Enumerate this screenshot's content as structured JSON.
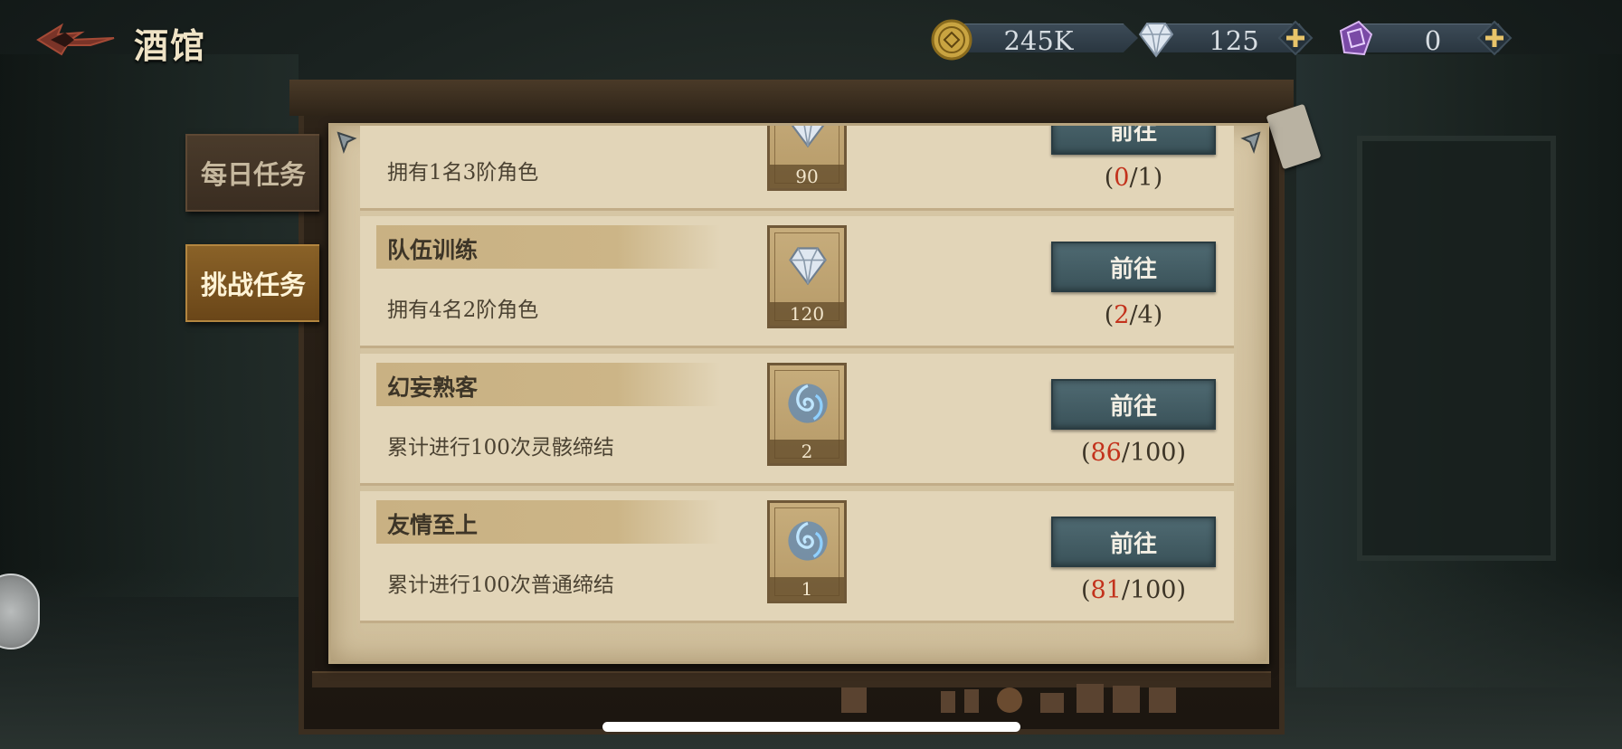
{
  "header": {
    "title": "酒馆"
  },
  "currencies": [
    {
      "name": "coin",
      "icon": "coin-icon",
      "value": "245K"
    },
    {
      "name": "diamond",
      "icon": "diamond-icon",
      "value": "125"
    },
    {
      "name": "crystal",
      "icon": "purple-crystal-icon",
      "value": "0"
    }
  ],
  "tabs": [
    {
      "label": "每日任务",
      "active": false
    },
    {
      "label": "挑战任务",
      "active": true
    }
  ],
  "tasks": [
    {
      "title": "",
      "description": "拥有1名3阶角色",
      "reward_icon": "diamond-icon",
      "reward_qty": "90",
      "button": "前往",
      "progress_current": "0",
      "progress_total": "1"
    },
    {
      "title": "队伍训练",
      "description": "拥有4名2阶角色",
      "reward_icon": "diamond-icon",
      "reward_qty": "120",
      "button": "前往",
      "progress_current": "2",
      "progress_total": "4"
    },
    {
      "title": "幻妄熟客",
      "description": "累计进行100次灵骸缔结",
      "reward_icon": "blue-spirit-icon",
      "reward_qty": "2",
      "button": "前往",
      "progress_current": "86",
      "progress_total": "100"
    },
    {
      "title": "友情至上",
      "description": "累计进行100次普通缔结",
      "reward_icon": "blue-spirit-icon",
      "reward_qty": "1",
      "button": "前往",
      "progress_current": "81",
      "progress_total": "100"
    }
  ],
  "colors": {
    "progress_current": "#c3321c",
    "button_bg": "#4f6a72",
    "active_tab": "#8a6228",
    "parchment": "#d7c7a6"
  }
}
